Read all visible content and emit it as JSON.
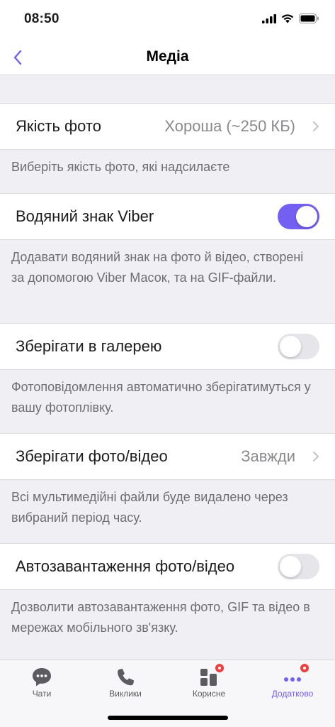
{
  "status_bar": {
    "time": "08:50"
  },
  "header": {
    "title": "Медіа"
  },
  "settings": [
    {
      "label": "Якість фото",
      "value": "Хороша (~250 КБ)",
      "type": "link",
      "footer": "Виберіть якість фото, які надсилаєте"
    },
    {
      "label": "Водяний знак Viber",
      "type": "toggle",
      "enabled": true,
      "footer": "Додавати водяний знак на фото й відео, створені за допомогою Viber Масок, та на GIF-файли."
    },
    {
      "label": "Зберігати в галерею",
      "type": "toggle",
      "enabled": false,
      "footer": "Фотоповідомлення автоматично зберігатимуться у вашу фотоплівку."
    },
    {
      "label": "Зберігати фото/відео",
      "value": "Завжди",
      "type": "link",
      "footer": "Всі мультимедійні файли буде видалено через вибраний період часу."
    },
    {
      "label": "Автозавантаження фото/відео",
      "type": "toggle",
      "enabled": false,
      "footer": "Дозволити автозавантаження фото, GIF та відео в мережах мобільного зв'язку."
    }
  ],
  "tab_bar": {
    "tabs": [
      {
        "label": "Чати",
        "icon": "chat-bubble-icon",
        "active": false,
        "badge": false
      },
      {
        "label": "Виклики",
        "icon": "phone-icon",
        "active": false,
        "badge": false
      },
      {
        "label": "Корисне",
        "icon": "explore-icon",
        "active": false,
        "badge": true
      },
      {
        "label": "Додатково",
        "icon": "more-dots-icon",
        "active": true,
        "badge": true
      }
    ]
  },
  "colors": {
    "accent": "#7360f2",
    "background": "#efeff4",
    "badge": "#ef3e3e",
    "secondary_text": "#6d6d72"
  }
}
